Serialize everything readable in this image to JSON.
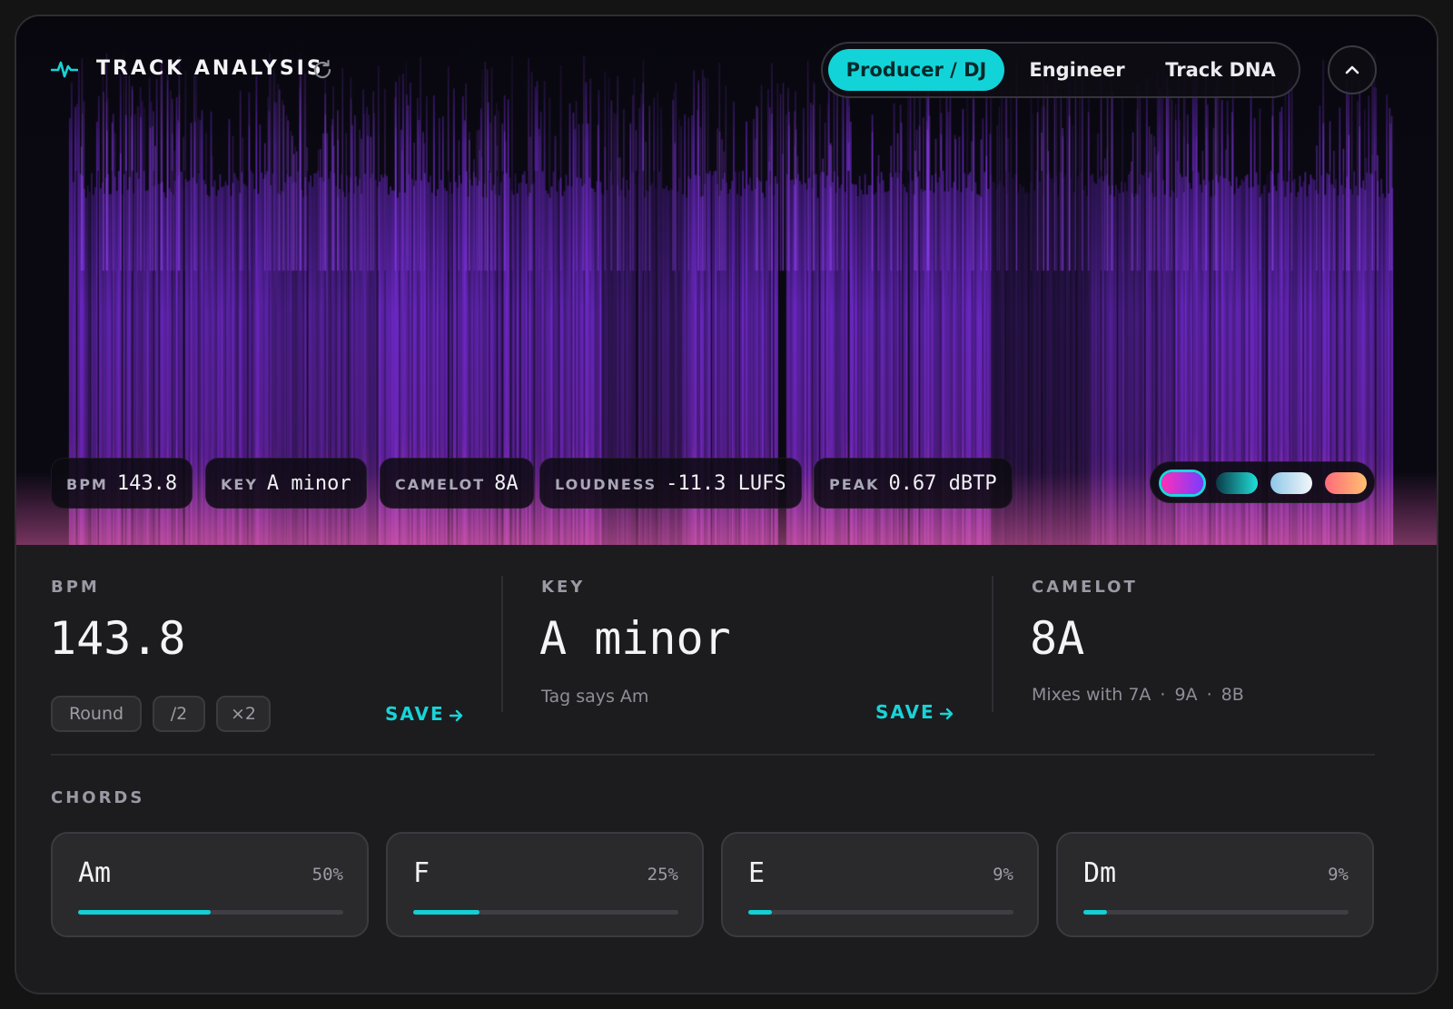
{
  "header": {
    "title": "TRACK ANALYSIS",
    "modes": [
      "Producer / DJ",
      "Engineer",
      "Track DNA"
    ],
    "active_mode": "Producer / DJ"
  },
  "pills": [
    {
      "key": "BPM",
      "value": "143.8"
    },
    {
      "key": "KEY",
      "value": "A minor"
    },
    {
      "key": "CAMELOT",
      "value": "8A"
    },
    {
      "key": "LOUDNESS",
      "value": "-11.3 LUFS"
    },
    {
      "key": "PEAK",
      "value": "0.67 dBTP"
    }
  ],
  "palettes": [
    {
      "from": "#ff2fb8",
      "to": "#7a3cff",
      "selected": true
    },
    {
      "from": "#0a3a48",
      "to": "#21e0d8",
      "selected": false
    },
    {
      "from": "#8ec8e8",
      "to": "#f2f6fa",
      "selected": false
    },
    {
      "from": "#ff6a7a",
      "to": "#ffc070",
      "selected": false
    }
  ],
  "bpm": {
    "label": "BPM",
    "value": "143.8",
    "actions": [
      "Round",
      "/2",
      "×2"
    ],
    "save_label": "SAVE"
  },
  "key": {
    "label": "KEY",
    "value": "A minor",
    "tag_note": "Tag says Am",
    "save_label": "SAVE"
  },
  "camelot": {
    "label": "CAMELOT",
    "value": "8A",
    "mixes_prefix": "Mixes with",
    "mixes": [
      "7A",
      "9A",
      "8B"
    ]
  },
  "chords": {
    "label": "CHORDS",
    "items": [
      {
        "name": "Am",
        "percent": 50,
        "percent_label": "50%"
      },
      {
        "name": "F",
        "percent": 25,
        "percent_label": "25%"
      },
      {
        "name": "E",
        "percent": 9,
        "percent_label": "9%"
      },
      {
        "name": "Dm",
        "percent": 9,
        "percent_label": "9%"
      }
    ]
  },
  "colors": {
    "accent": "#14d0d4",
    "spectrogram": "#7b2ee0"
  }
}
